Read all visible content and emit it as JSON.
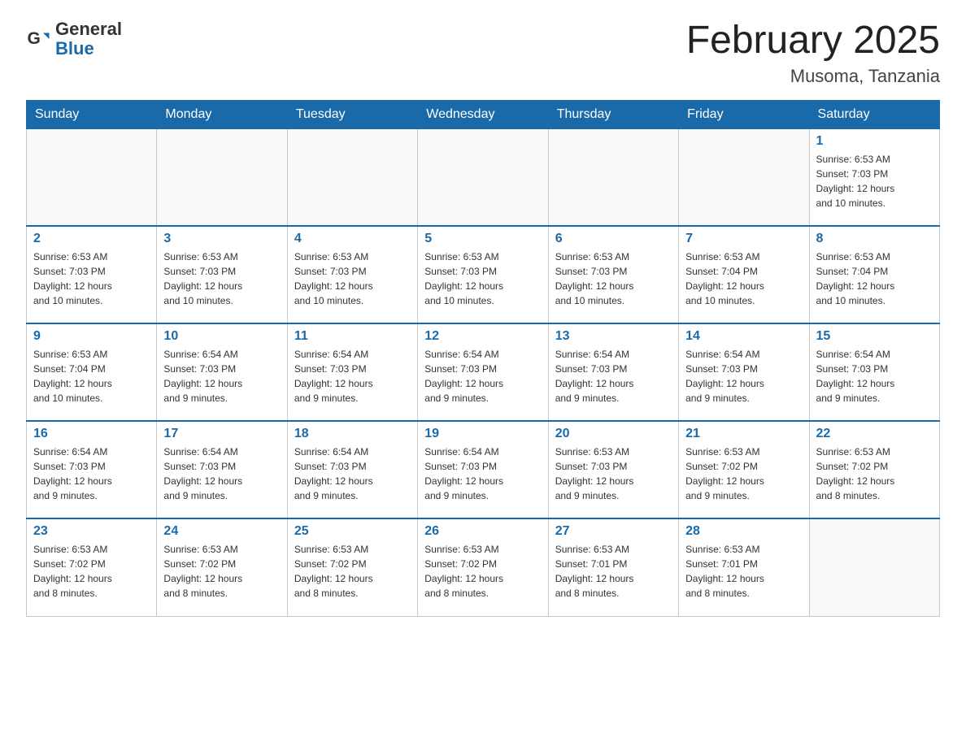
{
  "logo": {
    "general": "General",
    "blue": "Blue"
  },
  "header": {
    "month_title": "February 2025",
    "location": "Musoma, Tanzania"
  },
  "days_of_week": [
    "Sunday",
    "Monday",
    "Tuesday",
    "Wednesday",
    "Thursday",
    "Friday",
    "Saturday"
  ],
  "weeks": [
    [
      {
        "day": "",
        "info": ""
      },
      {
        "day": "",
        "info": ""
      },
      {
        "day": "",
        "info": ""
      },
      {
        "day": "",
        "info": ""
      },
      {
        "day": "",
        "info": ""
      },
      {
        "day": "",
        "info": ""
      },
      {
        "day": "1",
        "info": "Sunrise: 6:53 AM\nSunset: 7:03 PM\nDaylight: 12 hours\nand 10 minutes."
      }
    ],
    [
      {
        "day": "2",
        "info": "Sunrise: 6:53 AM\nSunset: 7:03 PM\nDaylight: 12 hours\nand 10 minutes."
      },
      {
        "day": "3",
        "info": "Sunrise: 6:53 AM\nSunset: 7:03 PM\nDaylight: 12 hours\nand 10 minutes."
      },
      {
        "day": "4",
        "info": "Sunrise: 6:53 AM\nSunset: 7:03 PM\nDaylight: 12 hours\nand 10 minutes."
      },
      {
        "day": "5",
        "info": "Sunrise: 6:53 AM\nSunset: 7:03 PM\nDaylight: 12 hours\nand 10 minutes."
      },
      {
        "day": "6",
        "info": "Sunrise: 6:53 AM\nSunset: 7:03 PM\nDaylight: 12 hours\nand 10 minutes."
      },
      {
        "day": "7",
        "info": "Sunrise: 6:53 AM\nSunset: 7:04 PM\nDaylight: 12 hours\nand 10 minutes."
      },
      {
        "day": "8",
        "info": "Sunrise: 6:53 AM\nSunset: 7:04 PM\nDaylight: 12 hours\nand 10 minutes."
      }
    ],
    [
      {
        "day": "9",
        "info": "Sunrise: 6:53 AM\nSunset: 7:04 PM\nDaylight: 12 hours\nand 10 minutes."
      },
      {
        "day": "10",
        "info": "Sunrise: 6:54 AM\nSunset: 7:03 PM\nDaylight: 12 hours\nand 9 minutes."
      },
      {
        "day": "11",
        "info": "Sunrise: 6:54 AM\nSunset: 7:03 PM\nDaylight: 12 hours\nand 9 minutes."
      },
      {
        "day": "12",
        "info": "Sunrise: 6:54 AM\nSunset: 7:03 PM\nDaylight: 12 hours\nand 9 minutes."
      },
      {
        "day": "13",
        "info": "Sunrise: 6:54 AM\nSunset: 7:03 PM\nDaylight: 12 hours\nand 9 minutes."
      },
      {
        "day": "14",
        "info": "Sunrise: 6:54 AM\nSunset: 7:03 PM\nDaylight: 12 hours\nand 9 minutes."
      },
      {
        "day": "15",
        "info": "Sunrise: 6:54 AM\nSunset: 7:03 PM\nDaylight: 12 hours\nand 9 minutes."
      }
    ],
    [
      {
        "day": "16",
        "info": "Sunrise: 6:54 AM\nSunset: 7:03 PM\nDaylight: 12 hours\nand 9 minutes."
      },
      {
        "day": "17",
        "info": "Sunrise: 6:54 AM\nSunset: 7:03 PM\nDaylight: 12 hours\nand 9 minutes."
      },
      {
        "day": "18",
        "info": "Sunrise: 6:54 AM\nSunset: 7:03 PM\nDaylight: 12 hours\nand 9 minutes."
      },
      {
        "day": "19",
        "info": "Sunrise: 6:54 AM\nSunset: 7:03 PM\nDaylight: 12 hours\nand 9 minutes."
      },
      {
        "day": "20",
        "info": "Sunrise: 6:53 AM\nSunset: 7:03 PM\nDaylight: 12 hours\nand 9 minutes."
      },
      {
        "day": "21",
        "info": "Sunrise: 6:53 AM\nSunset: 7:02 PM\nDaylight: 12 hours\nand 9 minutes."
      },
      {
        "day": "22",
        "info": "Sunrise: 6:53 AM\nSunset: 7:02 PM\nDaylight: 12 hours\nand 8 minutes."
      }
    ],
    [
      {
        "day": "23",
        "info": "Sunrise: 6:53 AM\nSunset: 7:02 PM\nDaylight: 12 hours\nand 8 minutes."
      },
      {
        "day": "24",
        "info": "Sunrise: 6:53 AM\nSunset: 7:02 PM\nDaylight: 12 hours\nand 8 minutes."
      },
      {
        "day": "25",
        "info": "Sunrise: 6:53 AM\nSunset: 7:02 PM\nDaylight: 12 hours\nand 8 minutes."
      },
      {
        "day": "26",
        "info": "Sunrise: 6:53 AM\nSunset: 7:02 PM\nDaylight: 12 hours\nand 8 minutes."
      },
      {
        "day": "27",
        "info": "Sunrise: 6:53 AM\nSunset: 7:01 PM\nDaylight: 12 hours\nand 8 minutes."
      },
      {
        "day": "28",
        "info": "Sunrise: 6:53 AM\nSunset: 7:01 PM\nDaylight: 12 hours\nand 8 minutes."
      },
      {
        "day": "",
        "info": ""
      }
    ]
  ]
}
